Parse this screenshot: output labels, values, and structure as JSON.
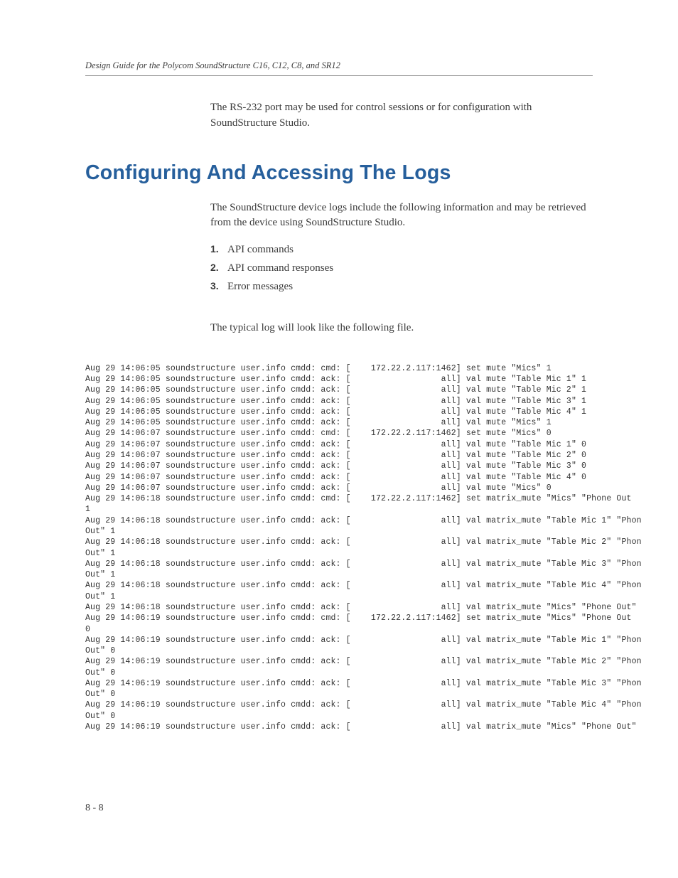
{
  "header": {
    "running_title": "Design Guide for the Polycom SoundStructure C16, C12, C8, and SR12"
  },
  "intro_paragraph": "The RS-232 port may be used for control sessions or for configuration with SoundStructure Studio.",
  "section": {
    "heading": "Configuring And Accessing The Logs",
    "lead": "The SoundStructure device logs include the following information and may be retrieved from the device using SoundStructure Studio.",
    "list": [
      "API commands",
      "API command responses",
      "Error messages"
    ],
    "post_list": "The typical log will look like the following file."
  },
  "log_lines": [
    "Aug 29 14:06:05 soundstructure user.info cmdd: cmd: [    172.22.2.117:1462] set mute \"Mics\" 1",
    "Aug 29 14:06:05 soundstructure user.info cmdd: ack: [                  all] val mute \"Table Mic 1\" 1",
    "Aug 29 14:06:05 soundstructure user.info cmdd: ack: [                  all] val mute \"Table Mic 2\" 1",
    "Aug 29 14:06:05 soundstructure user.info cmdd: ack: [                  all] val mute \"Table Mic 3\" 1",
    "Aug 29 14:06:05 soundstructure user.info cmdd: ack: [                  all] val mute \"Table Mic 4\" 1",
    "Aug 29 14:06:05 soundstructure user.info cmdd: ack: [                  all] val mute \"Mics\" 1",
    "Aug 29 14:06:07 soundstructure user.info cmdd: cmd: [    172.22.2.117:1462] set mute \"Mics\" 0",
    "Aug 29 14:06:07 soundstructure user.info cmdd: ack: [                  all] val mute \"Table Mic 1\" 0",
    "Aug 29 14:06:07 soundstructure user.info cmdd: ack: [                  all] val mute \"Table Mic 2\" 0",
    "Aug 29 14:06:07 soundstructure user.info cmdd: ack: [                  all] val mute \"Table Mic 3\" 0",
    "Aug 29 14:06:07 soundstructure user.info cmdd: ack: [                  all] val mute \"Table Mic 4\" 0",
    "Aug 29 14:06:07 soundstructure user.info cmdd: ack: [                  all] val mute \"Mics\" 0",
    "Aug 29 14:06:18 soundstructure user.info cmdd: cmd: [    172.22.2.117:1462] set matrix_mute \"Mics\" \"Phone Out",
    "1",
    "Aug 29 14:06:18 soundstructure user.info cmdd: ack: [                  all] val matrix_mute \"Table Mic 1\" \"Phon",
    "Out\" 1",
    "Aug 29 14:06:18 soundstructure user.info cmdd: ack: [                  all] val matrix_mute \"Table Mic 2\" \"Phon",
    "Out\" 1",
    "Aug 29 14:06:18 soundstructure user.info cmdd: ack: [                  all] val matrix_mute \"Table Mic 3\" \"Phon",
    "Out\" 1",
    "Aug 29 14:06:18 soundstructure user.info cmdd: ack: [                  all] val matrix_mute \"Table Mic 4\" \"Phon",
    "Out\" 1",
    "Aug 29 14:06:18 soundstructure user.info cmdd: ack: [                  all] val matrix_mute \"Mics\" \"Phone Out\"",
    "Aug 29 14:06:19 soundstructure user.info cmdd: cmd: [    172.22.2.117:1462] set matrix_mute \"Mics\" \"Phone Out",
    "0",
    "Aug 29 14:06:19 soundstructure user.info cmdd: ack: [                  all] val matrix_mute \"Table Mic 1\" \"Phon",
    "Out\" 0",
    "Aug 29 14:06:19 soundstructure user.info cmdd: ack: [                  all] val matrix_mute \"Table Mic 2\" \"Phon",
    "Out\" 0",
    "Aug 29 14:06:19 soundstructure user.info cmdd: ack: [                  all] val matrix_mute \"Table Mic 3\" \"Phon",
    "Out\" 0",
    "Aug 29 14:06:19 soundstructure user.info cmdd: ack: [                  all] val matrix_mute \"Table Mic 4\" \"Phon",
    "Out\" 0",
    "Aug 29 14:06:19 soundstructure user.info cmdd: ack: [                  all] val matrix_mute \"Mics\" \"Phone Out\""
  ],
  "page_number": "8 - 8"
}
